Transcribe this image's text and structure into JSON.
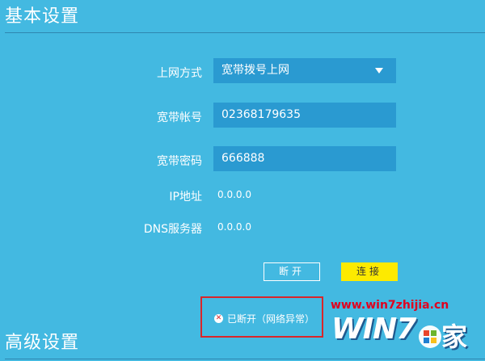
{
  "sections": {
    "basic_title": "基本设置",
    "advanced_title": "高级设置"
  },
  "form": {
    "connection_mode": {
      "label": "上网方式",
      "value": "宽带拨号上网"
    },
    "account": {
      "label": "宽带帐号",
      "value": "02368179635"
    },
    "password": {
      "label": "宽带密码",
      "value": "666888"
    },
    "ip": {
      "label": "IP地址",
      "value": "0.0.0.0"
    },
    "dns": {
      "label": "DNS服务器",
      "value": "0.0.0.0"
    }
  },
  "buttons": {
    "disconnect_label": "断开",
    "connect_label": "连接"
  },
  "status": {
    "icon": "error-x-icon",
    "text": "已断开（网络异常）"
  },
  "watermark": {
    "url": "www.win7zhijia.cn",
    "logo_text": "WIN7",
    "logo_suffix": "家"
  },
  "colors": {
    "background": "#43b9e1",
    "field": "#2a9ad1",
    "connect_button": "#fdea00",
    "highlight_box": "#d9262a"
  }
}
